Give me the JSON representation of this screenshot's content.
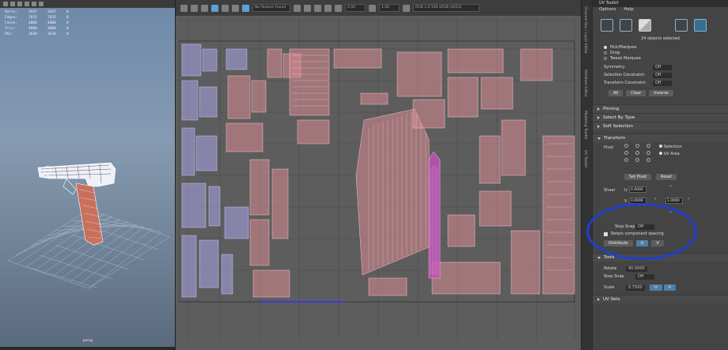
{
  "hud": {
    "rows": [
      {
        "label": "Verts:",
        "a": "3947",
        "b": "3947",
        "c": "0"
      },
      {
        "label": "Edges:",
        "a": "7835",
        "b": "7835",
        "c": "0"
      },
      {
        "label": "Faces:",
        "a": "4000",
        "b": "4000",
        "c": "0"
      },
      {
        "label": "Tris:",
        "a": "4000",
        "b": "4000",
        "c": "0"
      },
      {
        "label": "UVs:",
        "a": "3630",
        "b": "3630",
        "c": "0"
      }
    ]
  },
  "viewport": {
    "camera_label": "persp"
  },
  "uv_toolbar": {
    "field_texture": "No Texture Found",
    "field_value_a": "0.00",
    "field_value_b": "1.00",
    "field_colorspace": "RGB 1.0 500 sRGB (ACES)"
  },
  "side_tabs": [
    "Channel Box / Layer Editor",
    "Attribute Editor",
    "Modeling Toolkit",
    "UV Toolkit"
  ],
  "panel": {
    "title": "UV Toolkit",
    "menu": [
      "Options",
      "Help"
    ],
    "selection_count": "24 objects selected",
    "pick_modes": [
      {
        "label": "Pick/Marquee",
        "on": true
      },
      {
        "label": "Drag",
        "on": false
      },
      {
        "label": "Tweak Marquee",
        "on": false
      }
    ],
    "symmetry_label": "Symmetry:",
    "symmetry_value": "Off",
    "sel_constraint_label": "Selection Constraint:",
    "sel_constraint_value": "Off",
    "transform_constraint_label": "Transform Constraint:",
    "transform_constraint_value": "Off",
    "select_buttons": [
      "All",
      "Clear",
      "Inverse"
    ],
    "sections_top": [
      "Pinning",
      "Select By Type",
      "Soft Selection"
    ],
    "transform_section": "Transform",
    "pivot_label": "Pivot",
    "pivot_options": [
      "Selection",
      "UV Area"
    ],
    "pivot_buttons": [
      "Set Pivot",
      "Reset"
    ],
    "shear_label": "Shear",
    "shear_u_label": "U",
    "shear_v_label": "V",
    "shear_u_value": "0.0000",
    "shear_v_value": "0.0000",
    "move_value": "1.0000",
    "step_snap_label": "Step Snap",
    "step_snap_value": "Off",
    "retain_spacing": "Retain component spacing",
    "distribute_label": "Distribute",
    "distribute_u": "U",
    "distribute_v": "V",
    "tools_section": "Tools",
    "rotate_label": "Rotate",
    "rotate_value": "90.0000",
    "step_snap2_label": "Step Snap",
    "step_snap2_value": "Off",
    "scale_label": "Scale",
    "scale_value": "0.7500",
    "scale_u": "U",
    "scale_v": "V",
    "uv_sets_section": "UV Sets"
  },
  "colors": {
    "uv_shell_red": "#d98a91",
    "uv_shell_blue": "#a7a6e8",
    "uv_selected": "#c052b5",
    "annotation": "#1d3fd6"
  }
}
